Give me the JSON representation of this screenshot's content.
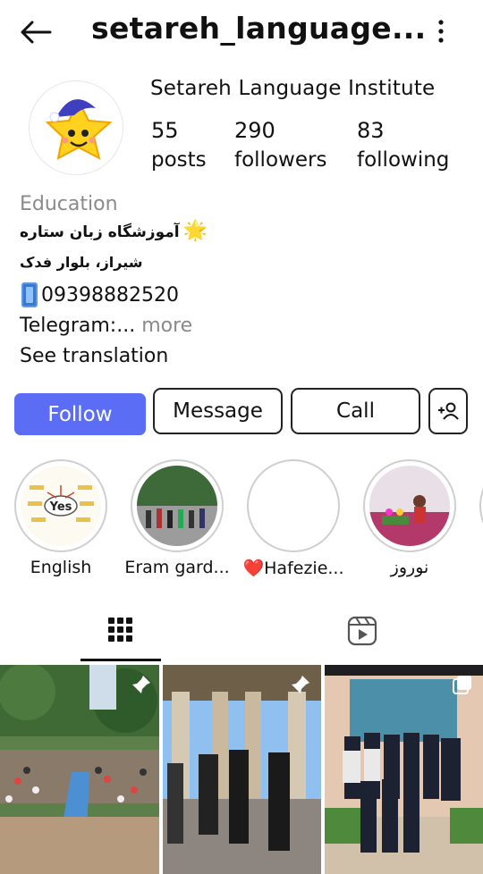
{
  "header": {
    "handle": "setareh_language...",
    "back_icon": "back-arrow-icon",
    "menu_icon": "kebab-menu-icon"
  },
  "profile": {
    "display_name": "Setareh Language Institute",
    "stats": {
      "posts_count": "55",
      "posts_label": "posts",
      "followers_count": "290",
      "followers_label": "followers",
      "following_count": "83",
      "following_label": "following"
    },
    "category": "Education",
    "bio_line1": "آموزشگاه زبان ستاره",
    "bio_line2": "شیراز، بلوار فدک",
    "phone": "09398882520",
    "telegram": "Telegram:...",
    "more_label": " more",
    "see_translation": "See translation"
  },
  "actions": {
    "follow": "Follow",
    "message": "Message",
    "call": "Call"
  },
  "highlights": [
    {
      "caption": "English"
    },
    {
      "caption": "Eram gard..."
    },
    {
      "caption": "❤️Hafezie..."
    },
    {
      "caption": "نوروز"
    }
  ],
  "tabs": {
    "grid_icon": "grid-icon",
    "reels_icon": "reels-icon"
  },
  "colors": {
    "follow_button": "#5b6df5",
    "muted_text": "#8a8a8a",
    "text": "#111111"
  }
}
